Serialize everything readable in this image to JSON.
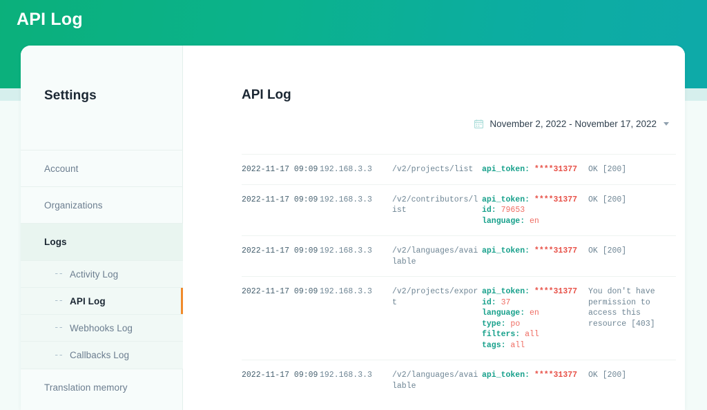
{
  "header": {
    "app_title": "API Log",
    "gradient_from": "#0bb07b",
    "gradient_to": "#0eaaa9"
  },
  "sidebar": {
    "title": "Settings",
    "items": [
      {
        "label": "Account",
        "type": "top",
        "state": "normal"
      },
      {
        "label": "Organizations",
        "type": "top",
        "state": "normal"
      },
      {
        "label": "Logs",
        "type": "top",
        "state": "active-parent"
      },
      {
        "label": "Activity Log",
        "type": "sub",
        "state": "normal",
        "marker": "--"
      },
      {
        "label": "API Log",
        "type": "sub",
        "state": "current",
        "marker": "--"
      },
      {
        "label": "Webhooks Log",
        "type": "sub",
        "state": "normal",
        "marker": "--"
      },
      {
        "label": "Callbacks Log",
        "type": "sub",
        "state": "normal",
        "marker": "--"
      },
      {
        "label": "Translation memory",
        "type": "top",
        "state": "normal"
      }
    ],
    "active_marker_color": "#f08a2b"
  },
  "main": {
    "page_title": "API Log",
    "date_range": {
      "icon": "calendar-icon",
      "value": "November 2, 2022 - November 17, 2022",
      "caret": "chevron-down-icon"
    },
    "log_rows": [
      {
        "timestamp": "2022-11-17 09:09",
        "ip": "192.168.3.3",
        "endpoint": "/v2/projects/list",
        "params": [
          {
            "key": "api_token:",
            "value": "****31377"
          }
        ],
        "status": "OK [200]"
      },
      {
        "timestamp": "2022-11-17 09:09",
        "ip": "192.168.3.3",
        "endpoint": "/v2/contributors/list",
        "params": [
          {
            "key": "api_token:",
            "value": "****31377"
          },
          {
            "key": "id:",
            "value": "79653"
          },
          {
            "key": "language:",
            "value": "en"
          }
        ],
        "status": "OK [200]"
      },
      {
        "timestamp": "2022-11-17 09:09",
        "ip": "192.168.3.3",
        "endpoint": "/v2/languages/available",
        "params": [
          {
            "key": "api_token:",
            "value": "****31377"
          }
        ],
        "status": "OK [200]"
      },
      {
        "timestamp": "2022-11-17 09:09",
        "ip": "192.168.3.3",
        "endpoint": "/v2/projects/export",
        "params": [
          {
            "key": "api_token:",
            "value": "****31377"
          },
          {
            "key": "id:",
            "value": "37"
          },
          {
            "key": "language:",
            "value": "en"
          },
          {
            "key": "type:",
            "value": "po"
          },
          {
            "key": "filters:",
            "value": "all"
          },
          {
            "key": "tags:",
            "value": "all"
          }
        ],
        "status": "You don't have permission to access this resource [403]"
      },
      {
        "timestamp": "2022-11-17 09:09",
        "ip": "192.168.3.3",
        "endpoint": "/v2/languages/available",
        "params": [
          {
            "key": "api_token:",
            "value": "****31377"
          }
        ],
        "status": "OK [200]"
      }
    ]
  },
  "colors": {
    "param_key": "#17a08b",
    "param_value": "#ef6c62",
    "accent_orange": "#f08a2b",
    "sidebar_active_bg": "#e9f5f0"
  }
}
